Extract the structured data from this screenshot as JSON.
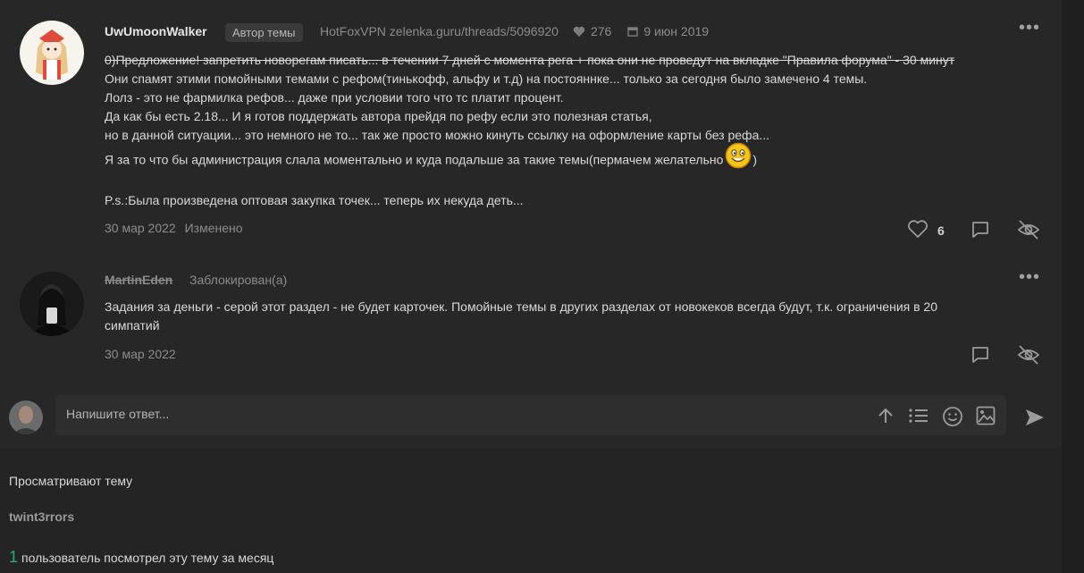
{
  "posts": [
    {
      "username": "UwUmoonWalker",
      "badge": "Автор темы",
      "link": "HotFoxVPN zelenka.guru/threads/5096920",
      "likes_total": "276",
      "join_date": "9 июн 2019",
      "lines": {
        "l1": "0)Предложение! запретить новорегам писать... в течении 7 дней с момента рега + пока они не проведут на вкладке \"Правила форума\" - 30 минут",
        "l2": "Они спамят этими помойными темами с рефом(тинькофф, альфу и т.д) на постояннке... только за сегодня было замечено 4 темы.",
        "l3": "Лолз - это не фармилка рефов... даже при условии того что тс платит процент.",
        "l4": "Да как бы есть 2.18... И я готов поддержать автора прейдя по рефу если это полезная статья,",
        "l5": "но в данной ситуации... это немного не то... так же просто можно кинуть ссылку на оформление карты без рефа...",
        "l6a": "Я за то что бы администрация слала моментально и куда подальше за такие темы(пермачем желательно",
        "l6b": ")",
        "l7": "P.s.:Была произведена оптовая закупка точек... теперь их некуда деть..."
      },
      "date": "30 мар 2022",
      "edited": "Изменено",
      "like_count": "6"
    },
    {
      "username": "MartinEden",
      "status": "Заблокирован(а)",
      "lines": {
        "l1": "Задания за деньги - серой этот раздел - не будет карточек. Помойные темы в других разделах от новокеков всегда будут, т.к. ограничения в 20",
        "l2": "симпатий"
      },
      "date": "30 мар 2022"
    }
  ],
  "composer": {
    "placeholder": "Напишите ответ..."
  },
  "viewers": {
    "title": "Просматривают тему",
    "names": [
      "twint3rrors"
    ],
    "month_count": "1",
    "month_text": "пользователь посмотрел эту тему за месяц"
  },
  "icons": {
    "like": "heart-icon",
    "reply": "comment-icon",
    "hide": "eye-off-icon",
    "more": "more-icon",
    "upload": "arrow-up-icon",
    "list": "list-icon",
    "emoji": "smile-icon",
    "image": "image-icon",
    "send": "send-icon",
    "calendar": "calendar-icon"
  },
  "colors": {
    "background": "#272727",
    "accent_green": "#2bad72",
    "muted": "#8c8c8c"
  }
}
